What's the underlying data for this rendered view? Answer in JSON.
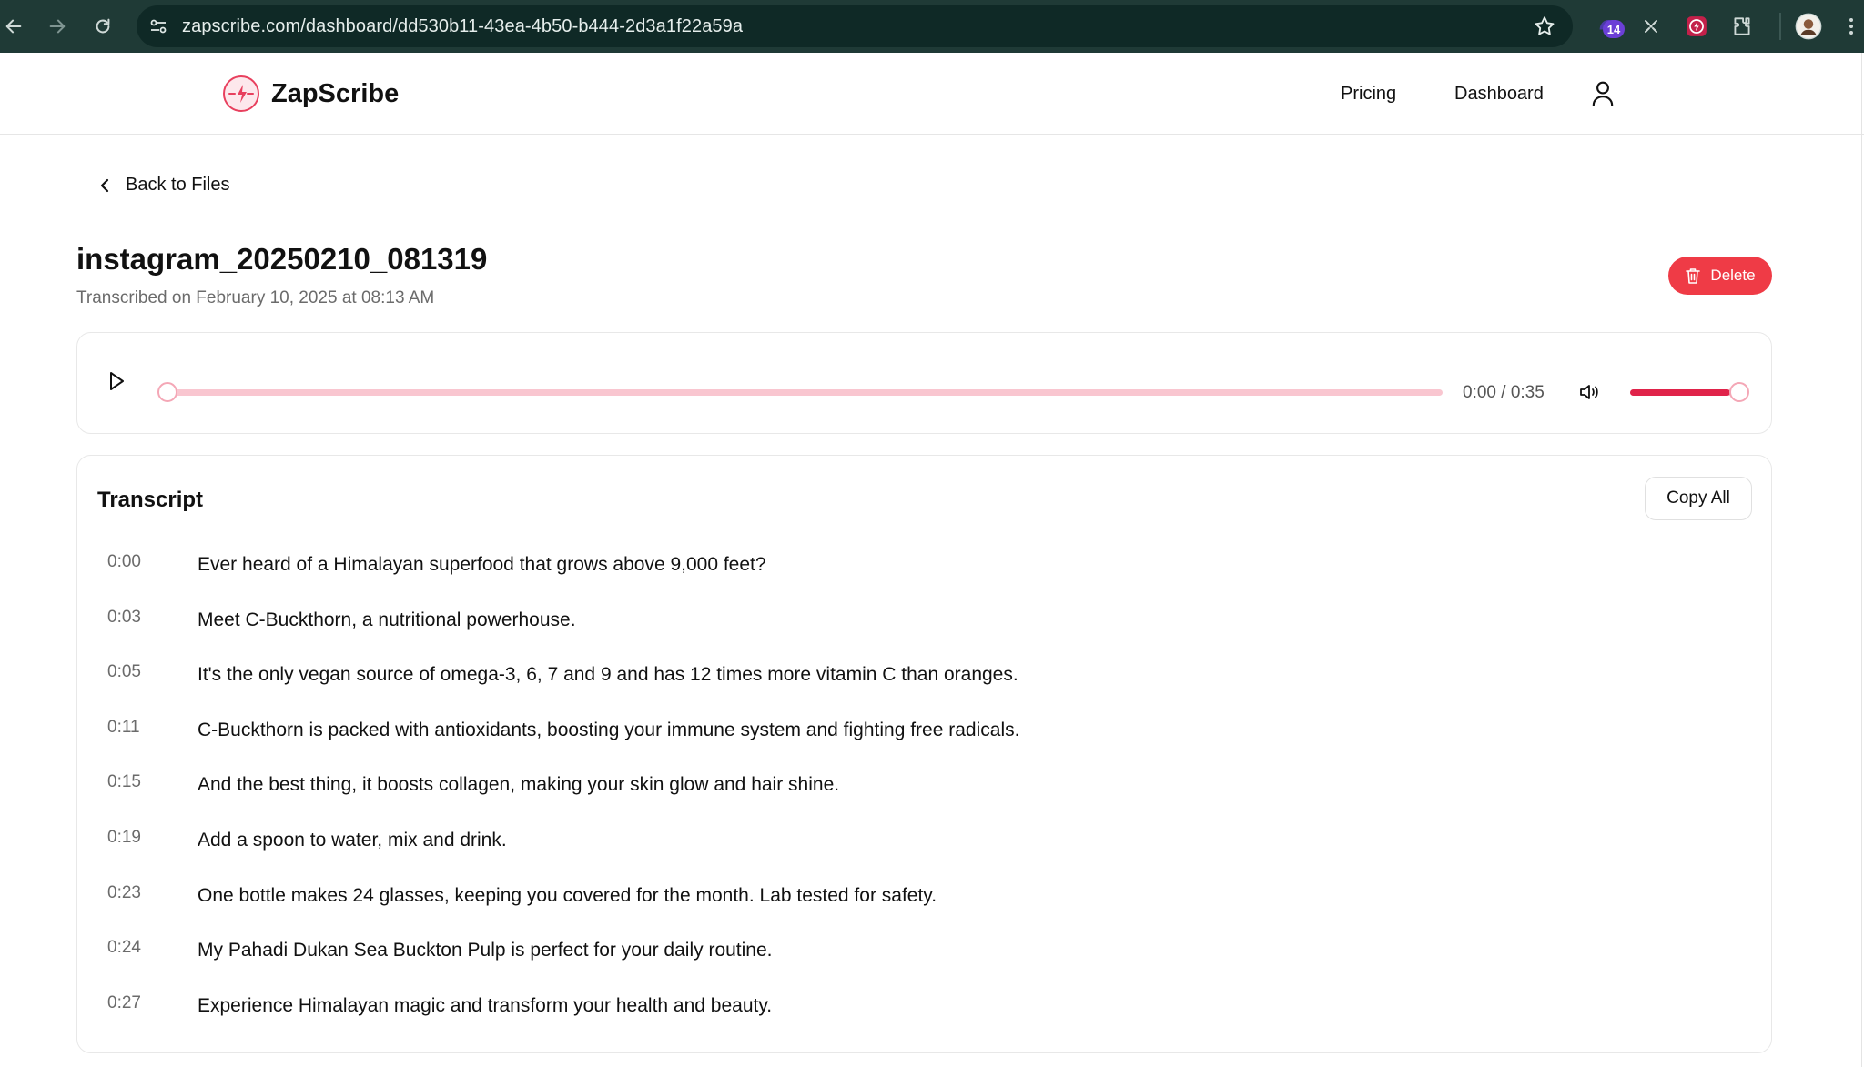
{
  "browser": {
    "url": "zapscribe.com/dashboard/dd530b11-43ea-4b50-b444-2d3a1f22a59a",
    "extension_badge": "14"
  },
  "header": {
    "brand": "ZapScribe",
    "nav": {
      "pricing": "Pricing",
      "dashboard": "Dashboard"
    }
  },
  "page": {
    "back_label": "Back to Files",
    "title": "instagram_20250210_081319",
    "subtitle": "Transcribed on February 10, 2025 at 08:13 AM",
    "delete_label": "Delete"
  },
  "player": {
    "time": "0:00 / 0:35",
    "progress": 0,
    "volume": 0.9
  },
  "transcript": {
    "title": "Transcript",
    "copy_label": "Copy All",
    "rows": [
      {
        "ts": "0:00",
        "text": "Ever heard of a Himalayan superfood that grows above 9,000 feet?"
      },
      {
        "ts": "0:03",
        "text": "Meet C-Buckthorn, a nutritional powerhouse."
      },
      {
        "ts": "0:05",
        "text": "It's the only vegan source of omega-3, 6, 7 and 9 and has 12 times more vitamin C than oranges."
      },
      {
        "ts": "0:11",
        "text": "C-Buckthorn is packed with antioxidants, boosting your immune system and fighting free radicals."
      },
      {
        "ts": "0:15",
        "text": "And the best thing, it boosts collagen, making your skin glow and hair shine."
      },
      {
        "ts": "0:19",
        "text": "Add a spoon to water, mix and drink."
      },
      {
        "ts": "0:23",
        "text": "One bottle makes 24 glasses, keeping you covered for the month. Lab tested for safety."
      },
      {
        "ts": "0:24",
        "text": "My Pahadi Dukan Sea Buckton Pulp is perfect for your daily routine."
      },
      {
        "ts": "0:27",
        "text": "Experience Himalayan magic and transform your health and beauty."
      }
    ]
  },
  "colors": {
    "chrome": "#1f3a36",
    "accent": "#e0234a",
    "delete": "#ef3b46",
    "track": "#f9c6d0"
  }
}
